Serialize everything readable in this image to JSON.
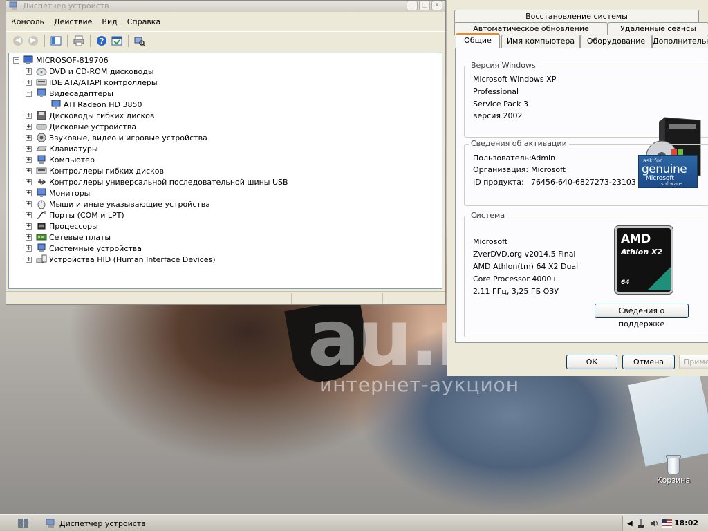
{
  "device_manager": {
    "title": "Диспетчер устройств",
    "menu": [
      "Консоль",
      "Действие",
      "Вид",
      "Справка"
    ],
    "tree": {
      "root": "MICROSOF-819706",
      "items": [
        {
          "label": "DVD и CD-ROM дисководы",
          "icon": "cd-drive-icon",
          "expanded": false
        },
        {
          "label": "IDE ATA/ATAPI контроллеры",
          "icon": "ide-controller-icon",
          "expanded": false
        },
        {
          "label": "Видеоадаптеры",
          "icon": "display-adapter-icon",
          "expanded": true
        },
        {
          "label": "ATI Radeon HD 3850",
          "icon": "display-adapter-icon",
          "child": true
        },
        {
          "label": "Дисководы гибких дисков",
          "icon": "floppy-drive-icon",
          "expanded": false
        },
        {
          "label": "Дисковые устройства",
          "icon": "disk-drive-icon",
          "expanded": false
        },
        {
          "label": "Звуковые, видео и игровые устройства",
          "icon": "sound-device-icon",
          "expanded": false
        },
        {
          "label": "Клавиатуры",
          "icon": "keyboard-icon",
          "expanded": false
        },
        {
          "label": "Компьютер",
          "icon": "computer-icon",
          "expanded": false
        },
        {
          "label": "Контроллеры гибких дисков",
          "icon": "floppy-controller-icon",
          "expanded": false
        },
        {
          "label": "Контроллеры универсальной последовательной шины USB",
          "icon": "usb-icon",
          "expanded": false
        },
        {
          "label": "Мониторы",
          "icon": "monitor-icon",
          "expanded": false
        },
        {
          "label": "Мыши и иные указывающие устройства",
          "icon": "mouse-icon",
          "expanded": false
        },
        {
          "label": "Порты (COM и LPT)",
          "icon": "port-icon",
          "expanded": false
        },
        {
          "label": "Процессоры",
          "icon": "processor-icon",
          "expanded": false
        },
        {
          "label": "Сетевые платы",
          "icon": "network-card-icon",
          "expanded": false
        },
        {
          "label": "Системные устройства",
          "icon": "system-device-icon",
          "expanded": false
        },
        {
          "label": "Устройства HID (Human Interface Devices)",
          "icon": "hid-device-icon",
          "expanded": false
        }
      ]
    }
  },
  "system_properties": {
    "tabs_row1": [
      "Восстановление системы"
    ],
    "tabs_row2": [
      "Автоматическое обновление",
      "Удаленные сеансы"
    ],
    "tabs_row3": [
      "Общие",
      "Имя компьютера",
      "Оборудование",
      "Дополнительно"
    ],
    "active_tab": "Общие",
    "windows_version": {
      "title": "Версия Windows",
      "lines": [
        "Microsoft Windows XP",
        "Professional",
        "Service Pack 3",
        "версия 2002"
      ]
    },
    "activation": {
      "title": "Сведения об активации",
      "user_label": "Пользователь:",
      "user_value": "Admin",
      "org_label": "Организация:",
      "org_value": "Microsoft",
      "pid_label": "ID продукта:",
      "pid_value": "76456-640-6827273-23103",
      "genuine_badge": {
        "line1": "ask for",
        "line2": "genuine",
        "line3": "Microsoft",
        "line4": "software"
      }
    },
    "system": {
      "title": "Система",
      "lines": [
        "Microsoft",
        "ZverDVD.org v2014.5 Final",
        "AMD Athlon(tm) 64 X2 Dual",
        "Core Processor 4000+",
        "2.11 ГГц, 3,25 ГБ ОЗУ"
      ],
      "amd_badge": {
        "brand": "AMD",
        "model": "Athlon X2",
        "bits": "64"
      },
      "support_button": "Сведения о поддержке"
    },
    "buttons": {
      "ok": "ОК",
      "cancel": "Отмена",
      "apply": "Применить"
    }
  },
  "desktop": {
    "watermark": "au.ru",
    "watermark_sub": "интернет-аукцион",
    "recycle_bin": "Корзина"
  },
  "taskbar": {
    "task_label": "Диспетчер устройств",
    "clock": "18:02"
  },
  "colors": {
    "xp_face": "#ece9d8",
    "tab_highlight": "#e68b2c",
    "button_border": "#003c74",
    "tree_border": "#7f9db9"
  }
}
